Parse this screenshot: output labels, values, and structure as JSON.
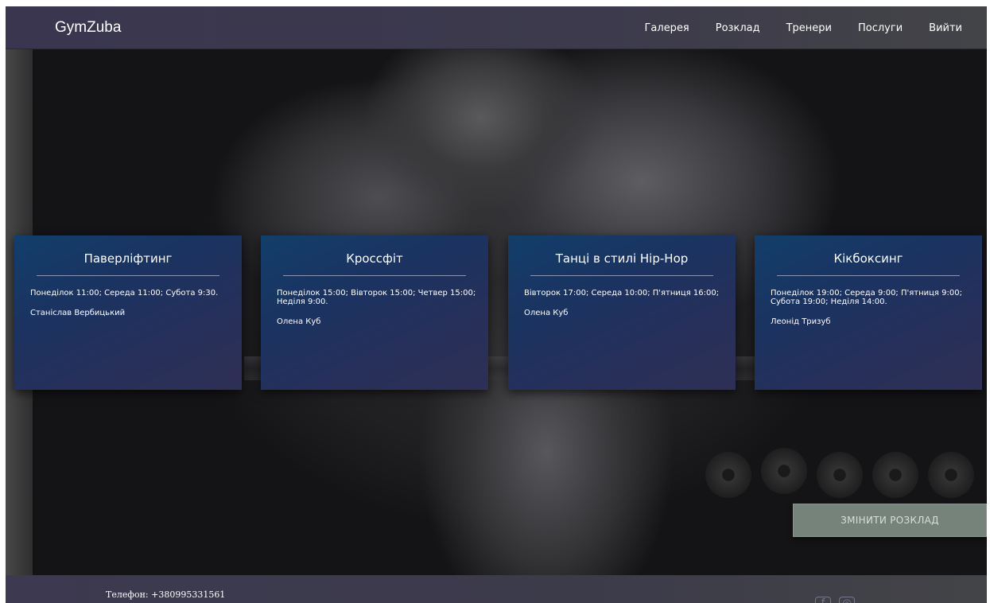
{
  "header": {
    "logo": "GymZuba",
    "nav": [
      {
        "label": "Галерея"
      },
      {
        "label": "Розклад"
      },
      {
        "label": "Тренери"
      },
      {
        "label": "Послуги"
      },
      {
        "label": "Вийти"
      }
    ]
  },
  "schedule": [
    {
      "title": "Паверліфтинг",
      "days": "Понеділок 11:00; Середа 11:00; Субота 9:30.",
      "coach": "Станіслав Вербицький"
    },
    {
      "title": "Кроссфіт",
      "days": "Понеділок 15:00; Вівторок 15:00; Четвер 15:00; Неділя 9:00.",
      "coach": "Олена Куб"
    },
    {
      "title": "Танці в стилі Hip-Hop",
      "days": "Вівторок 17:00; Середа 10:00; П'ятниця 16:00;",
      "coach": "Олена Куб"
    },
    {
      "title": "Кікбоксинг",
      "days": "Понеділок 19:00; Середа 9:00; П'ятниця 9:00; Субота 19:00; Неділя 14:00.",
      "coach": "Леонід Тризуб"
    }
  ],
  "change_schedule_button": "ЗМІНИТИ РОЗКЛАД",
  "footer": {
    "phone": "Телефон: +380995331561"
  },
  "icons": {
    "facebook": "facebook-icon",
    "instagram": "instagram-icon"
  },
  "colors": {
    "header_bg": "#3a3650",
    "card_bg": "#1c3260",
    "button_bg": "#75837b"
  }
}
